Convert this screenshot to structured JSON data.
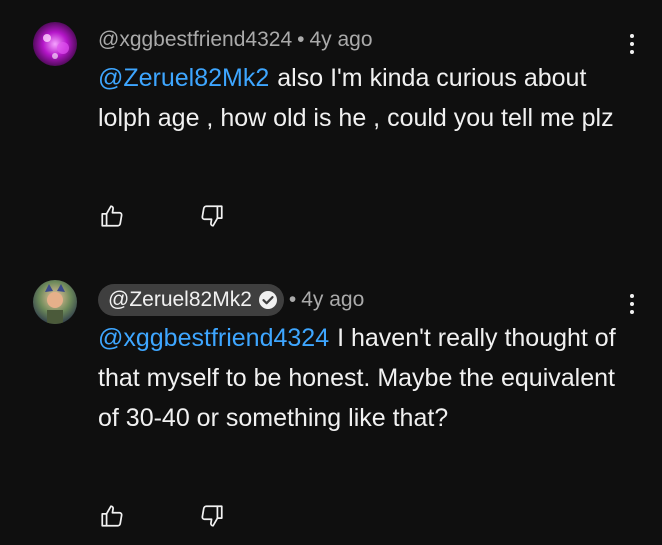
{
  "comments": [
    {
      "author": "@xggbestfriend4324",
      "time": "4y ago",
      "mention": "@Zeruel82Mk2",
      "text": "also I'm kinda curious about lolph age , how old is he , could you tell me plz",
      "verified": false
    },
    {
      "author": "@Zeruel82Mk2",
      "time": "4y ago",
      "mention": "@xggbestfriend4324",
      "text": "I haven't really thought of that myself to be honest. Maybe the equivalent of 30-40 or something like that?",
      "verified": true
    }
  ],
  "ui": {
    "separator": "•",
    "like_icon": "thumbs-up-icon",
    "dislike_icon": "thumbs-down-icon",
    "menu_icon": "more-vert-icon",
    "verified_icon": "verified-check-icon"
  },
  "colors": {
    "background": "#0f0f0f",
    "text": "#f1f1f1",
    "secondary": "#aaaaaa",
    "mention": "#3ea6ff",
    "pill": "#3f3f3f"
  }
}
